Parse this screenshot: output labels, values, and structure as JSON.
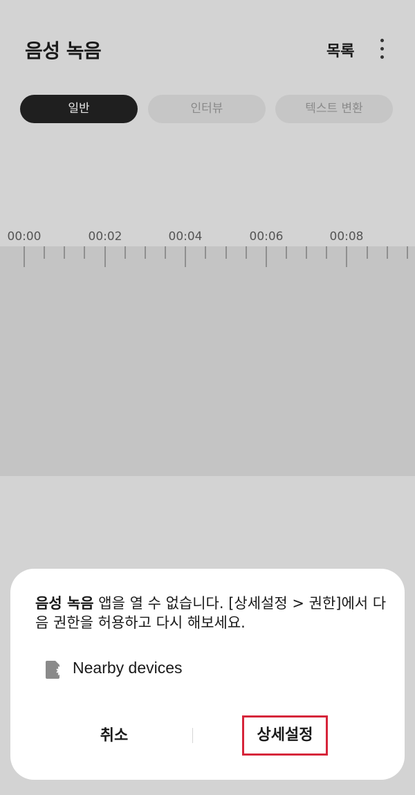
{
  "header": {
    "title": "음성 녹음",
    "list_label": "목록",
    "more_icon": "more-vertical-icon"
  },
  "tabs": [
    {
      "label": "일반",
      "active": true
    },
    {
      "label": "인터뷰",
      "active": false
    },
    {
      "label": "텍스트 변환",
      "active": false
    }
  ],
  "timeline": {
    "labels": [
      "00:00",
      "00:02",
      "00:04",
      "00:06",
      "00:08"
    ]
  },
  "dialog": {
    "app_name": "음성 녹음",
    "message_rest": " 앱을 열 수 없습니다. [상세설정 > 권한]에서 다음 권한을 허용하고 다시 해보세요.",
    "permission": {
      "icon": "nearby-devices-icon",
      "label": "Nearby devices"
    },
    "cancel_label": "취소",
    "settings_label": "상세설정"
  },
  "colors": {
    "highlight_border": "#d6243a",
    "active_tab_bg": "#1f1f1f",
    "background": "#d3d3d3"
  }
}
